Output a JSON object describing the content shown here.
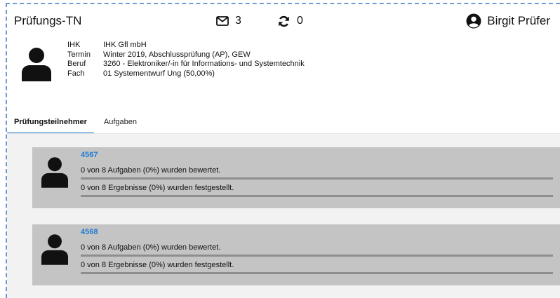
{
  "header": {
    "title": "Prüfungs-TN",
    "mail_count": "3",
    "sync_count": "0",
    "user_name": "Birgit Prüfer",
    "icons": {
      "mail": "mail-icon",
      "sync": "sync-icon",
      "user": "user-circle-icon"
    }
  },
  "exam_info": [
    {
      "label": "IHK",
      "value": "IHK Gfl mbH"
    },
    {
      "label": "Termin",
      "value": "Winter 2019, Abschlussprüfung (AP), GEW"
    },
    {
      "label": "Beruf",
      "value": "3260 - Elektroniker/-in für Informations- und Systemtechnik"
    },
    {
      "label": "Fach",
      "value": "01 Systementwurf Ung (50,00%)"
    }
  ],
  "tabs": [
    {
      "label": "Prüfungsteilnehmer",
      "active": true
    },
    {
      "label": "Aufgaben",
      "active": false
    }
  ],
  "participants": [
    {
      "id": "4567",
      "tasks_text": "0 von 8 Aufgaben (0%) wurden bewertet.",
      "tasks_progress": 0,
      "results_text": "0 von 8 Ergebnisse (0%) wurden festgestellt.",
      "results_progress": 0
    },
    {
      "id": "4568",
      "tasks_text": "0 von 8 Aufgaben (0%) wurden bewertet.",
      "tasks_progress": 0,
      "results_text": "0 von 8 Ergebnisse (0%) wurden festgestellt.",
      "results_progress": 0
    }
  ],
  "colors": {
    "accent": "#1f7ad6",
    "card_bg": "#c4c4c4",
    "list_bg": "#f2f2f2",
    "frame_dash": "#6f9bd0"
  }
}
